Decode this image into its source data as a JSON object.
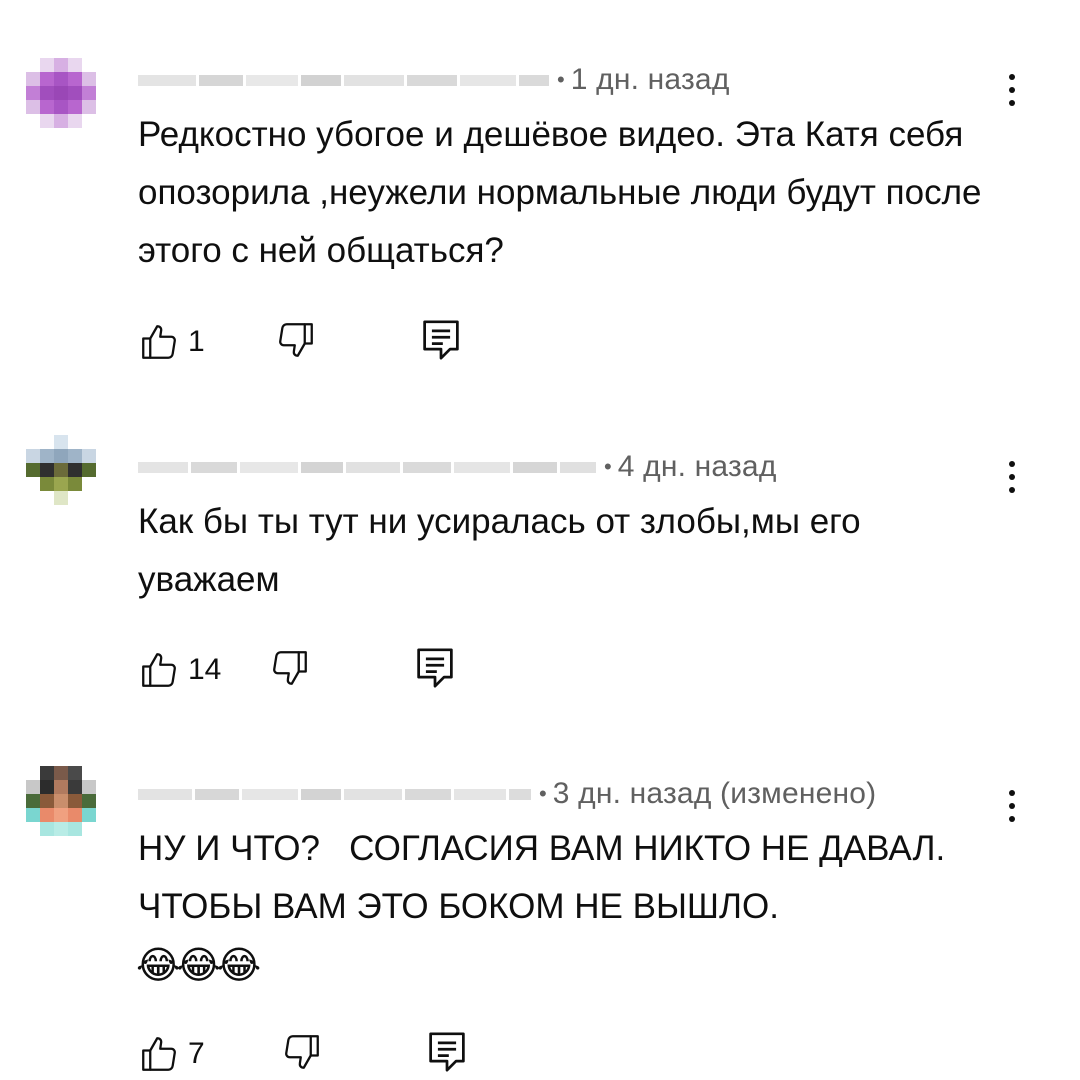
{
  "comments": [
    {
      "time": "1 дн. назад",
      "text": "Редкостно убогое и дешёвое видео. Эта Катя себя опозорила ,неужели нормальные люди будут после этого с ней общаться?",
      "likes": "1"
    },
    {
      "time": "4 дн. назад",
      "text": "Как бы ты тут ни усиралась от злобы,мы его уважаем",
      "likes": "14"
    },
    {
      "time": "3 дн. назад (изменено)",
      "text": "НУ И ЧТО?   СОГЛАСИЯ ВАМ НИКТО НЕ ДАВАЛ. ЧТОБЫ ВАМ ЭТО БОКОМ НЕ ВЫШЛО.",
      "emoji": "😂😂😂",
      "likes": "7"
    }
  ],
  "icons": {
    "like": "thumbs-up-icon",
    "dislike": "thumbs-down-icon",
    "reply": "reply-comment-icon",
    "menu": "more-vertical-icon"
  },
  "colors": {
    "text": "#0f0f0f",
    "meta": "#606060",
    "background": "#ffffff"
  }
}
